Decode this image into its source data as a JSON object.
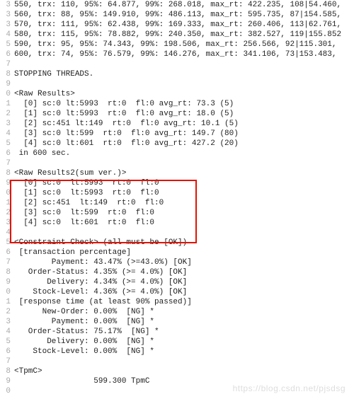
{
  "gutter_start_digits": [
    "3",
    "3",
    "3",
    "4",
    "5",
    "6",
    "7",
    "8",
    "9",
    "0",
    "1",
    "2",
    "3",
    "4",
    "5",
    "6",
    "7",
    "8",
    "9",
    "0",
    "1",
    "2",
    "3",
    "4",
    "5",
    "6",
    "7",
    "8",
    "9",
    "0",
    "1",
    "2",
    "3",
    "4",
    "5",
    "6",
    "7",
    "8",
    "9",
    "0"
  ],
  "code_lines": [
    "550, trx: 110, 95%: 64.877, 99%: 268.018, max_rt: 422.235, 108|54.460,",
    "560, trx: 88, 95%: 149.910, 99%: 486.113, max_rt: 595.735, 87|154.585,",
    "570, trx: 111, 95%: 62.438, 99%: 169.333, max_rt: 260.406, 113|62.761,",
    "580, trx: 115, 95%: 78.882, 99%: 240.350, max_rt: 382.527, 119|155.852",
    "590, trx: 95, 95%: 74.343, 99%: 198.506, max_rt: 256.566, 92|115.301, ",
    "600, trx: 74, 95%: 76.579, 99%: 146.276, max_rt: 341.106, 73|153.483, ",
    "",
    "STOPPING THREADS.",
    "",
    "<Raw Results>",
    "  [0] sc:0 lt:5993  rt:0  fl:0 avg_rt: 73.3 (5)",
    "  [1] sc:0 lt:5993  rt:0  fl:0 avg_rt: 18.0 (5)",
    "  [2] sc:451 lt:149  rt:0  fl:0 avg_rt: 10.1 (5)",
    "  [3] sc:0 lt:599  rt:0  fl:0 avg_rt: 149.7 (80)",
    "  [4] sc:0 lt:601  rt:0  fl:0 avg_rt: 427.2 (20)",
    " in 600 sec.",
    "",
    "<Raw Results2(sum ver.)>",
    "  [0] sc:0  lt:5993  rt:0  fl:0",
    "  [1] sc:0  lt:5993  rt:0  fl:0",
    "  [2] sc:451  lt:149  rt:0  fl:0",
    "  [3] sc:0  lt:599  rt:0  fl:0",
    "  [4] sc:0  lt:601  rt:0  fl:0",
    "",
    "<Constraint Check> (all must be [OK])",
    " [transaction percentage]",
    "        Payment: 43.47% (>=43.0%) [OK]",
    "   Order-Status: 4.35% (>= 4.0%) [OK]",
    "       Delivery: 4.34% (>= 4.0%) [OK]",
    "    Stock-Level: 4.36% (>= 4.0%) [OK]",
    " [response time (at least 90% passed)]",
    "      New-Order: 0.00%  [NG] *",
    "        Payment: 0.00%  [NG] *",
    "   Order-Status: 75.17%  [NG] *",
    "       Delivery: 0.00%  [NG] *",
    "    Stock-Level: 0.00%  [NG] *",
    "",
    "<TpmC>",
    "                 599.300 TpmC",
    ""
  ],
  "watermark": "https://blog.csdn.net/pjsdsg"
}
